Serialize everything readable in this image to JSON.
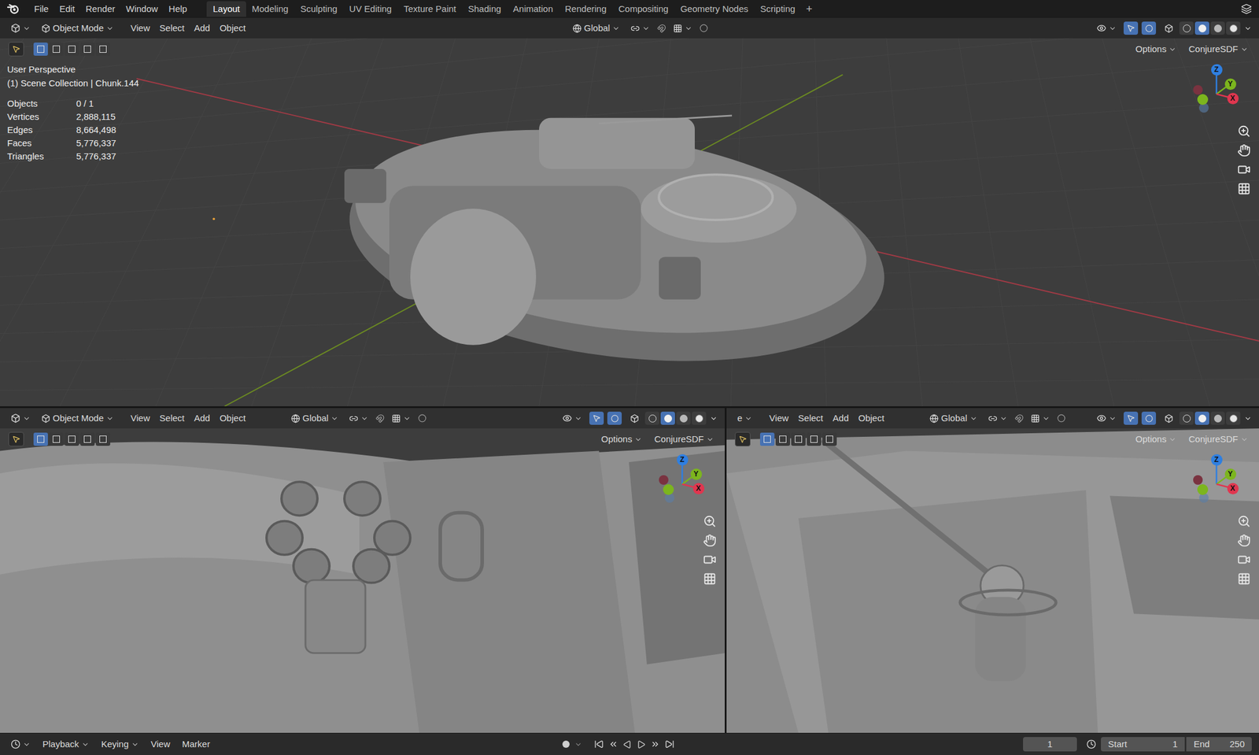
{
  "menubar": {
    "menus": [
      "File",
      "Edit",
      "Render",
      "Window",
      "Help"
    ],
    "workspaces": [
      {
        "label": "Layout",
        "selected": true
      },
      {
        "label": "Modeling",
        "selected": false
      },
      {
        "label": "Sculpting",
        "selected": false
      },
      {
        "label": "UV Editing",
        "selected": false
      },
      {
        "label": "Texture Paint",
        "selected": false
      },
      {
        "label": "Shading",
        "selected": false
      },
      {
        "label": "Animation",
        "selected": false
      },
      {
        "label": "Rendering",
        "selected": false
      },
      {
        "label": "Compositing",
        "selected": false
      },
      {
        "label": "Geometry Nodes",
        "selected": false
      },
      {
        "label": "Scripting",
        "selected": false
      }
    ],
    "add_workspace": "+"
  },
  "viewports": [
    {
      "name": "main",
      "editor_cut": false,
      "mode": "Object Mode",
      "menus": [
        "View",
        "Select",
        "Add",
        "Object"
      ],
      "orientation": "Global",
      "options": "Options",
      "addon": "ConjureSDF",
      "select_modes": [
        {
          "selected": true
        },
        {
          "selected": false
        },
        {
          "selected": false
        },
        {
          "selected": false
        },
        {
          "selected": false
        }
      ],
      "shading": [
        {
          "mode": "wireframe",
          "selected": false
        },
        {
          "mode": "solid",
          "selected": true
        },
        {
          "mode": "material",
          "selected": false
        },
        {
          "mode": "rendered",
          "selected": false
        }
      ],
      "overlay": {
        "view": "User Perspective",
        "collection": "(1) Scene Collection | Chunk.144",
        "stats": [
          {
            "label": "Objects",
            "value": "0 / 1"
          },
          {
            "label": "Vertices",
            "value": "2,888,115"
          },
          {
            "label": "Edges",
            "value": "8,664,498"
          },
          {
            "label": "Faces",
            "value": "5,776,337"
          },
          {
            "label": "Triangles",
            "value": "5,776,337"
          }
        ]
      },
      "gizmo": [
        {
          "axis": "Z",
          "color": "#2f7fe0"
        },
        {
          "axis": "Y",
          "color": "#7cb51e"
        },
        {
          "axis": "X",
          "color": "#e0364f"
        }
      ]
    },
    {
      "name": "detail-left",
      "editor_cut": false,
      "mode": "Object Mode",
      "menus": [
        "View",
        "Select",
        "Add",
        "Object"
      ],
      "orientation": "Global",
      "options": "Options",
      "addon": "ConjureSDF",
      "select_modes": [
        {
          "selected": true
        },
        {
          "selected": false
        },
        {
          "selected": false
        },
        {
          "selected": false
        },
        {
          "selected": false
        }
      ],
      "shading": [
        {
          "mode": "wireframe",
          "selected": false
        },
        {
          "mode": "solid",
          "selected": true
        },
        {
          "mode": "material",
          "selected": false
        },
        {
          "mode": "rendered",
          "selected": false
        }
      ],
      "gizmo": [
        {
          "axis": "Z",
          "color": "#2f7fe0"
        },
        {
          "axis": "Y",
          "color": "#7cb51e"
        },
        {
          "axis": "X",
          "color": "#e0364f"
        }
      ]
    },
    {
      "name": "detail-right",
      "editor_cut": true,
      "mode": "e",
      "menus": [
        "View",
        "Select",
        "Add",
        "Object"
      ],
      "orientation": "Global",
      "options": "Options",
      "addon": "ConjureSDF",
      "select_modes": [
        {
          "selected": true
        },
        {
          "selected": false
        },
        {
          "selected": false
        },
        {
          "selected": false
        },
        {
          "selected": false
        }
      ],
      "shading": [
        {
          "mode": "wireframe",
          "selected": false
        },
        {
          "mode": "solid",
          "selected": true
        },
        {
          "mode": "material",
          "selected": false
        },
        {
          "mode": "rendered",
          "selected": false
        }
      ],
      "gizmo": [
        {
          "axis": "Z",
          "color": "#2f7fe0"
        },
        {
          "axis": "Y",
          "color": "#7cb51e"
        },
        {
          "axis": "X",
          "color": "#e0364f"
        }
      ]
    }
  ],
  "timeline": {
    "menus": [
      "Playback",
      "Keying",
      "View",
      "Marker"
    ],
    "current_frame": "1",
    "start_label": "Start",
    "start": "1",
    "end_label": "End",
    "end": "250"
  }
}
